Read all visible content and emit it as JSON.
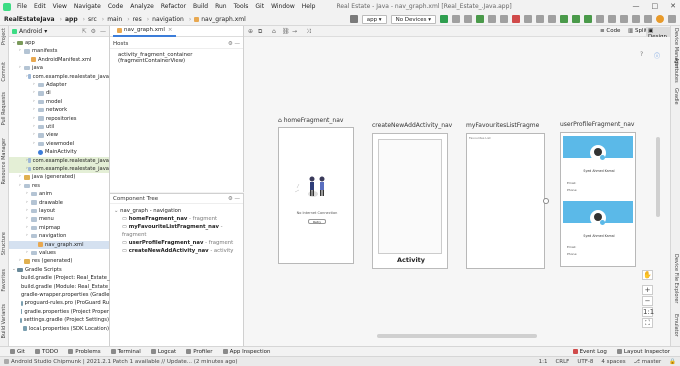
{
  "menu": {
    "items": [
      "File",
      "Edit",
      "View",
      "Navigate",
      "Code",
      "Analyze",
      "Refactor",
      "Build",
      "Run",
      "Tools",
      "Git",
      "Window",
      "Help"
    ],
    "window_title": "Real Estate - Java - nav_graph.xml [Real_Estate_.Java.app]"
  },
  "toolbar": {
    "breadcrumb": [
      "RealEstateJava",
      "app",
      "src",
      "main",
      "res",
      "navigation",
      "nav_graph.xml"
    ],
    "module_selector": "app",
    "device_selector": "No Devices"
  },
  "left_strip": {
    "labels": [
      "Project",
      "Commit",
      "Pull Requests",
      "Resource Manager",
      "Structure",
      "Favorites",
      "Build Variants"
    ]
  },
  "right_strip": {
    "labels": [
      "Device Manager",
      "Attributes",
      "Gradle",
      "Device File Explorer",
      "Emulator"
    ]
  },
  "project_panel": {
    "selector": "Android",
    "tree": [
      {
        "label": "app",
        "depth": 0,
        "kind": "module"
      },
      {
        "label": "manifests",
        "depth": 1,
        "kind": "folder"
      },
      {
        "label": "AndroidManifest.xml",
        "depth": 2,
        "kind": "file"
      },
      {
        "label": "java",
        "depth": 1,
        "kind": "folder"
      },
      {
        "label": "com.example.realestate_java",
        "depth": 2,
        "kind": "pkg"
      },
      {
        "label": "Adapter",
        "depth": 3,
        "kind": "folder"
      },
      {
        "label": "di",
        "depth": 3,
        "kind": "folder"
      },
      {
        "label": "model",
        "depth": 3,
        "kind": "folder"
      },
      {
        "label": "network",
        "depth": 3,
        "kind": "folder"
      },
      {
        "label": "repositories",
        "depth": 3,
        "kind": "folder"
      },
      {
        "label": "util",
        "depth": 3,
        "kind": "folder"
      },
      {
        "label": "view",
        "depth": 3,
        "kind": "folder"
      },
      {
        "label": "viewmodel",
        "depth": 3,
        "kind": "folder"
      },
      {
        "label": "MainActivity",
        "depth": 3,
        "kind": "class"
      },
      {
        "label": "com.example.realestate_java",
        "depth": 2,
        "kind": "pkg",
        "highlight": "test"
      },
      {
        "label": "com.example.realestate_java",
        "depth": 2,
        "kind": "pkg",
        "highlight": "test"
      },
      {
        "label": "java (generated)",
        "depth": 1,
        "kind": "gen"
      },
      {
        "label": "res",
        "depth": 1,
        "kind": "folder"
      },
      {
        "label": "anim",
        "depth": 2,
        "kind": "folder"
      },
      {
        "label": "drawable",
        "depth": 2,
        "kind": "folder"
      },
      {
        "label": "layout",
        "depth": 2,
        "kind": "folder"
      },
      {
        "label": "menu",
        "depth": 2,
        "kind": "folder"
      },
      {
        "label": "mipmap",
        "depth": 2,
        "kind": "folder"
      },
      {
        "label": "navigation",
        "depth": 2,
        "kind": "folder"
      },
      {
        "label": "nav_graph.xml",
        "depth": 3,
        "kind": "xml",
        "selected": true
      },
      {
        "label": "values",
        "depth": 2,
        "kind": "folder"
      },
      {
        "label": "res (generated)",
        "depth": 1,
        "kind": "gen"
      },
      {
        "label": "Gradle Scripts",
        "depth": 0,
        "kind": "gradle"
      },
      {
        "label": "build.gradle (Project: Real_Estate_",
        "depth": 1,
        "kind": "gfile"
      },
      {
        "label": "build.gradle (Module: Real_Estate_",
        "depth": 1,
        "kind": "gfile"
      },
      {
        "label": "gradle-wrapper.properties (Gradle",
        "depth": 1,
        "kind": "gfile"
      },
      {
        "label": "proguard-rules.pro (ProGuard Ru",
        "depth": 1,
        "kind": "gfile"
      },
      {
        "label": "gradle.properties (Project Proper",
        "depth": 1,
        "kind": "gfile"
      },
      {
        "label": "settings.gradle (Project Settings)",
        "depth": 1,
        "kind": "gfile"
      },
      {
        "label": "local.properties (SDK Location)",
        "depth": 1,
        "kind": "gfile"
      }
    ]
  },
  "file_tab": {
    "label": "nav_graph.xml"
  },
  "hosts_panel": {
    "title": "Hosts",
    "items": [
      "activity_fragment_container (fragmentContainerView)"
    ]
  },
  "component_tree": {
    "title": "Component Tree",
    "root": "nav_graph - navigation",
    "children": [
      {
        "name": "homeFragment_nav",
        "type": "fragment"
      },
      {
        "name": "myFavouriteListFragment_nav",
        "type": "fragment"
      },
      {
        "name": "userProfileFragment_nav",
        "type": "fragment"
      },
      {
        "name": "createNewAddActivity_nav",
        "type": "activity"
      }
    ]
  },
  "view_modes": [
    "Code",
    "Split",
    "Design"
  ],
  "destinations": [
    {
      "label": "homeFragment_nav",
      "is_start": true
    },
    {
      "label": "createNewAddActivity_nav",
      "inner_label": "Activity"
    },
    {
      "label": "myFavouritesListFragme"
    },
    {
      "label": "userProfileFragment_nav"
    }
  ],
  "home_screen": {
    "caption": "No Internet Connection",
    "button": "Retry"
  },
  "fav_screen": {
    "caption": "Favourites List"
  },
  "profile_screen": {
    "name": "Syed Ahmed Kamal",
    "fields": [
      "Email:",
      "Phone:"
    ]
  },
  "bottom_tabs": [
    "Git",
    "TODO",
    "Problems",
    "Terminal",
    "Logcat",
    "Profiler",
    "App Inspection"
  ],
  "bottom_right_tabs": [
    "Event Log",
    "Layout Inspector"
  ],
  "status": {
    "message": "Android Studio Chipmunk | 2021.2.1 Patch 1 available // Update... (2 minutes ago)",
    "position": "1:1",
    "line_sep": "CRLF",
    "encoding": "UTF-8",
    "indent": "4 spaces",
    "branch": "master"
  },
  "colors": {
    "accent": "#3c7dd9",
    "profile_header": "#5bb9e8",
    "selected_bg": "#d5e1f0",
    "test_pkg_bg": "#e4efd6"
  }
}
